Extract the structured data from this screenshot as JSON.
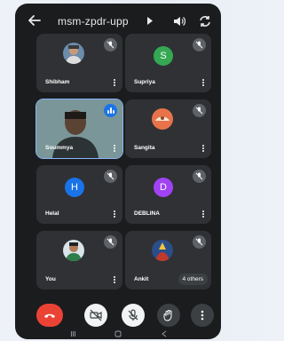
{
  "topbar": {
    "meeting_code": "msm-zpdr-upp"
  },
  "participants": [
    {
      "name": "Shibham",
      "avatar_type": "photo",
      "muted": true
    },
    {
      "name": "Supriya",
      "avatar_type": "letter",
      "initial": "S",
      "avatar_color": "#34a853",
      "muted": true
    },
    {
      "name": "Soummya",
      "avatar_type": "video",
      "speaking": true
    },
    {
      "name": "Sangita",
      "avatar_type": "photo",
      "muted": true
    },
    {
      "name": "Helal",
      "avatar_type": "letter",
      "initial": "H",
      "avatar_color": "#1a73e8",
      "muted": true
    },
    {
      "name": "DEBLINA",
      "avatar_type": "letter",
      "initial": "D",
      "avatar_color": "#a142f4",
      "muted": true
    },
    {
      "name": "You",
      "avatar_type": "photo",
      "muted": true
    },
    {
      "name": "Ankit",
      "avatar_type": "photo",
      "muted": true,
      "others_label": "4 others"
    }
  ],
  "controls": {
    "end_call": "end-call-icon",
    "camera": "camera-off-icon",
    "microphone": "mic-off-icon",
    "raise_hand": "raise-hand-icon",
    "more": "more-options-icon"
  },
  "colors": {
    "background": "#1b1c1e",
    "tile": "#303134",
    "end_call": "#ea4335"
  }
}
